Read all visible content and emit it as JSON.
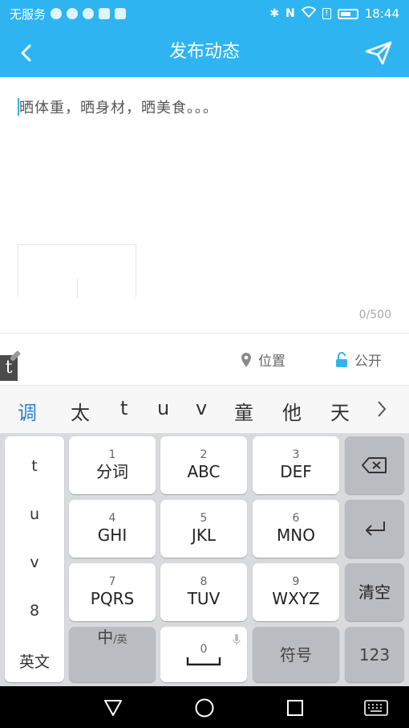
{
  "status_bar": {
    "carrier": "无服务",
    "time": "18:44"
  },
  "app_bar": {
    "title": "发布动态"
  },
  "editor": {
    "placeholder": "晒体重，晒身材，晒美食。。。",
    "counter": "0/500"
  },
  "options": {
    "location_label": "位置",
    "privacy_label": "公开"
  },
  "ime_badge": "t",
  "candidates": [
    "调",
    "太",
    "t",
    "u",
    "v",
    "童",
    "他",
    "天"
  ],
  "keyboard": {
    "left_column": [
      "t",
      "u",
      "v",
      "8",
      "英文"
    ],
    "keys": [
      {
        "num": "1",
        "label": "分词"
      },
      {
        "num": "2",
        "label": "ABC"
      },
      {
        "num": "3",
        "label": "DEF"
      },
      {
        "num": "4",
        "label": "GHI"
      },
      {
        "num": "5",
        "label": "JKL"
      },
      {
        "num": "6",
        "label": "MNO"
      },
      {
        "num": "7",
        "label": "PQRS"
      },
      {
        "num": "8",
        "label": "TUV"
      },
      {
        "num": "9",
        "label": "WXYZ"
      }
    ],
    "clear_label": "清空",
    "lang_main": "中",
    "lang_sub": "/英",
    "space_num": "0",
    "symbols_label": "符号",
    "numbers_label": "123"
  },
  "colors": {
    "accent": "#2fb4f2",
    "candidate_highlight": "#2b7fd0"
  }
}
